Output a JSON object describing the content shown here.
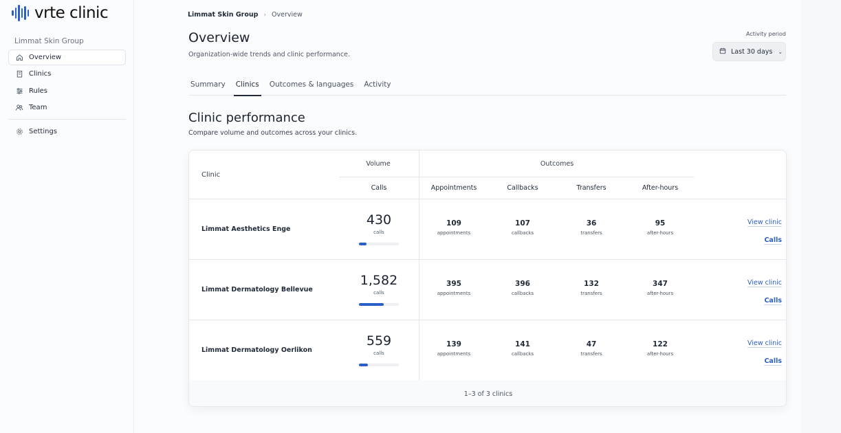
{
  "logo": {
    "text": "vrte clinic"
  },
  "sidebar": {
    "org": "Limmat Skin Group",
    "items": [
      {
        "label": "Overview",
        "icon": "home-icon",
        "active": true
      },
      {
        "label": "Clinics",
        "icon": "building-icon",
        "active": false
      },
      {
        "label": "Rules",
        "icon": "sliders-icon",
        "active": false
      },
      {
        "label": "Team",
        "icon": "users-icon",
        "active": false
      }
    ],
    "settings": {
      "label": "Settings",
      "icon": "gear-icon"
    }
  },
  "breadcrumb": {
    "org": "Limmat Skin Group",
    "page": "Overview"
  },
  "header": {
    "title": "Overview",
    "subtitle": "Organization-wide trends and clinic performance.",
    "period_label": "Activity period",
    "period_value": "Last 30 days"
  },
  "tabs": [
    {
      "label": "Summary",
      "active": false
    },
    {
      "label": "Clinics",
      "active": true
    },
    {
      "label": "Outcomes & languages",
      "active": false
    },
    {
      "label": "Activity",
      "active": false
    }
  ],
  "section": {
    "title": "Clinic performance",
    "subtitle": "Compare volume and outcomes across your clinics."
  },
  "table": {
    "headers": {
      "clinic": "Clinic",
      "volume": "Volume",
      "outcomes": "Outcomes",
      "calls": "Calls",
      "appointments": "Appointments",
      "callbacks": "Callbacks",
      "transfers": "Transfers",
      "after_hours": "After-hours"
    },
    "rows": [
      {
        "name": "Limmat Aesthetics Enge",
        "calls": "430",
        "calls_unit": "calls",
        "calls_share": 0.19,
        "appointments": "109",
        "appointments_unit": "appointments",
        "callbacks": "107",
        "callbacks_unit": "callbacks",
        "transfers": "36",
        "transfers_unit": "transfers",
        "after_hours": "95",
        "after_hours_unit": "after-hours",
        "link_view": "View clinic",
        "link_calls": "Calls"
      },
      {
        "name": "Limmat Dermatology Bellevue",
        "calls": "1,582",
        "calls_unit": "calls",
        "calls_share": 0.62,
        "appointments": "395",
        "appointments_unit": "appointments",
        "callbacks": "396",
        "callbacks_unit": "callbacks",
        "transfers": "132",
        "transfers_unit": "transfers",
        "after_hours": "347",
        "after_hours_unit": "after-hours",
        "link_view": "View clinic",
        "link_calls": "Calls"
      },
      {
        "name": "Limmat Dermatology Oerlikon",
        "calls": "559",
        "calls_unit": "calls",
        "calls_share": 0.22,
        "appointments": "139",
        "appointments_unit": "appointments",
        "callbacks": "141",
        "callbacks_unit": "callbacks",
        "transfers": "47",
        "transfers_unit": "transfers",
        "after_hours": "122",
        "after_hours_unit": "after-hours",
        "link_view": "View clinic",
        "link_calls": "Calls"
      }
    ],
    "footer": "1–3 of 3 clinics"
  },
  "colors": {
    "accent": "#2b5fc7",
    "text": "#1f2937"
  }
}
